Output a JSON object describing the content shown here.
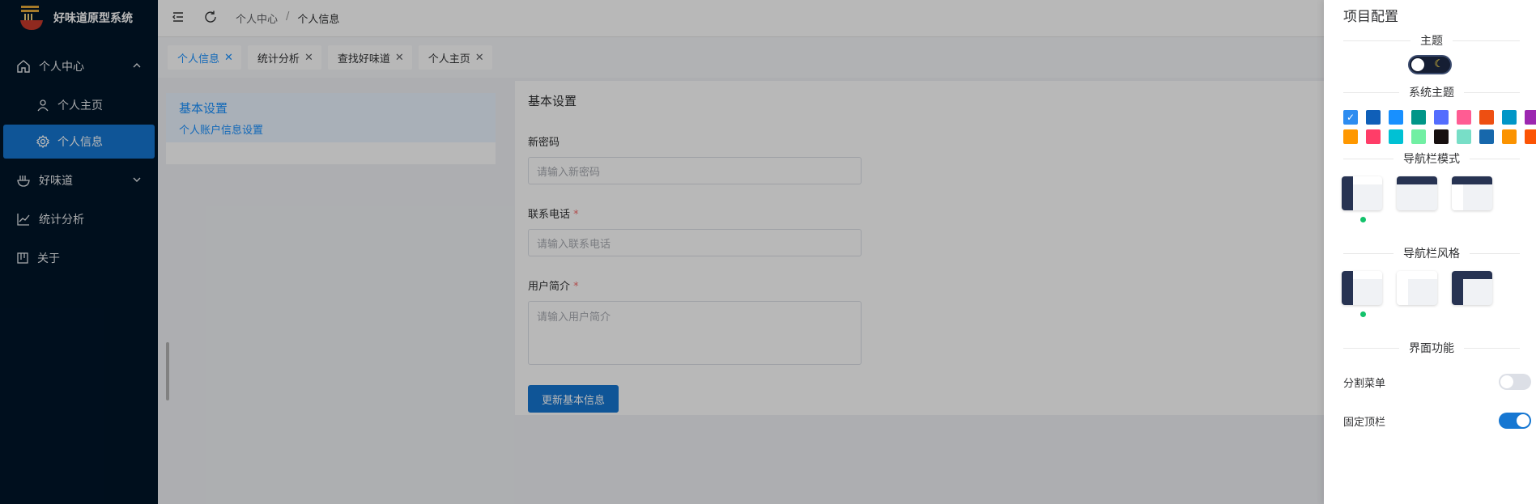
{
  "app": {
    "title": "好味道原型系统"
  },
  "sidebar": {
    "items": [
      {
        "label": "个人中心",
        "icon": "home-icon",
        "expanded": true
      },
      {
        "label": "个人主页",
        "icon": "user-icon"
      },
      {
        "label": "个人信息",
        "icon": "settings-icon",
        "active": true
      },
      {
        "label": "好味道",
        "icon": "bowl-icon",
        "expanded": false
      },
      {
        "label": "统计分析",
        "icon": "chart-icon"
      },
      {
        "label": "关于",
        "icon": "board-icon"
      }
    ]
  },
  "header": {
    "breadcrumb": [
      "个人中心",
      "个人信息"
    ],
    "separator": "/"
  },
  "tabs": [
    {
      "label": "个人信息",
      "active": true
    },
    {
      "label": "统计分析"
    },
    {
      "label": "查找好味道"
    },
    {
      "label": "个人主页"
    }
  ],
  "settings_list": {
    "title": "基本设置",
    "sub": "个人账户信息设置"
  },
  "form": {
    "title": "基本设置",
    "password_label": "新密码",
    "password_placeholder": "请输入新密码",
    "phone_label": "联系电话",
    "phone_placeholder": "请输入联系电话",
    "intro_label": "用户简介",
    "intro_placeholder": "请输入用户简介",
    "required_mark": "*",
    "submit_label": "更新基本信息"
  },
  "drawer": {
    "title": "项目配置",
    "theme_section": "主题",
    "system_theme_section": "系统主题",
    "nav_mode_section": "导航栏模式",
    "nav_style_section": "导航栏风格",
    "ui_section": "界面功能",
    "split_menu_label": "分割菜单",
    "fixed_header_label": "固定顶栏",
    "split_menu_on": false,
    "fixed_header_on": true,
    "swatch_colors": [
      "#2d8cf0",
      "#0f5fb8",
      "#1890ff",
      "#009688",
      "#536dfe",
      "#ff5c93",
      "#ee4f12",
      "#0096c7",
      "#9c27b0",
      "#ff9800",
      "#ff3d68",
      "#00c1d4",
      "#71efa3",
      "#171010",
      "#78dec7",
      "#1768ac",
      "#fb9300",
      "#fc5404"
    ],
    "selected_swatch": 0,
    "nav_mode_selected": 0,
    "nav_style_selected": 0
  }
}
